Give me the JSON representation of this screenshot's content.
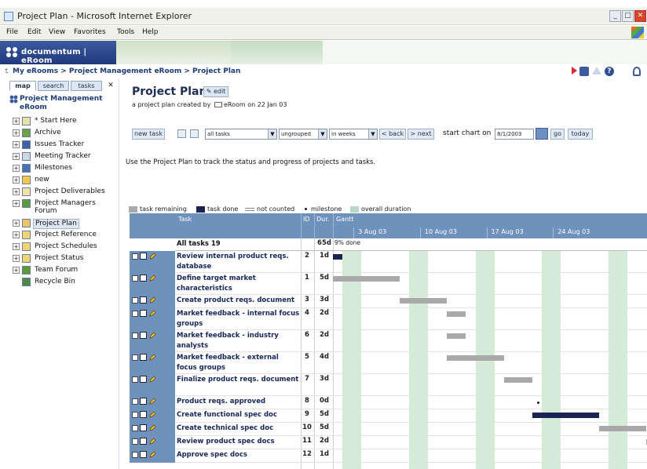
{
  "window": {
    "title": "Project Plan - Microsoft Internet Explorer"
  },
  "menu": [
    "File",
    "Edit",
    "View",
    "Favorites",
    "Tools",
    "Help"
  ],
  "brand": {
    "name": "documentum | eRoom"
  },
  "breadcrumb": "My eRooms > Project Management eRoom > Project Plan",
  "sidebar": {
    "tabs": [
      "map",
      "search",
      "tasks"
    ],
    "root": "Project Management eRoom",
    "items": [
      {
        "label": "* Start Here",
        "color": "#e9e2a6",
        "exp": "+"
      },
      {
        "label": "Archive",
        "color": "#6da14a",
        "exp": "+"
      },
      {
        "label": "Issues Tracker",
        "color": "#3f62a3",
        "exp": "+"
      },
      {
        "label": "Meeting Tracker",
        "color": "#cdd7e6",
        "exp": "+"
      },
      {
        "label": "Milestones",
        "color": "#4d6fb3",
        "exp": "+"
      },
      {
        "label": "new",
        "color": "#f2c94a",
        "exp": "+"
      },
      {
        "label": "Project Deliverables",
        "color": "#f2e3a8",
        "exp": "+"
      },
      {
        "label": "Project Managers",
        "label2": "Forum",
        "color": "#5d9a3f",
        "exp": "+"
      },
      {
        "label": "Project Plan",
        "color": "#e8c56a",
        "exp": "+",
        "selected": true
      },
      {
        "label": "Project Reference",
        "color": "#f0d478",
        "exp": "+"
      },
      {
        "label": "Project Schedules",
        "color": "#f0d478",
        "exp": "+"
      },
      {
        "label": "Project Status",
        "color": "#f0d478",
        "exp": "+"
      },
      {
        "label": "Team Forum",
        "color": "#5d9a3f",
        "exp": "+"
      },
      {
        "label": "Recycle Bin",
        "color": "#4d8a4a",
        "exp": ""
      }
    ]
  },
  "page": {
    "title": "Project Plan",
    "edit_label": "edit",
    "subtitle_before": "a project plan created by",
    "subtitle_after": "eRoom on 22 Jan 03",
    "description": "Use the Project Plan to track the status and progress of projects and tasks."
  },
  "toolbar": {
    "new_task": "new task",
    "filter": "all tasks",
    "grouping": "ungrouped",
    "scale": "in weeks",
    "back": "< back",
    "next": "> next",
    "start_label": "start chart on",
    "start_date": "8/1/2003",
    "go": "go",
    "today": "today"
  },
  "legend": {
    "remaining": "task remaining",
    "done": "task done",
    "not_counted": "not counted",
    "milestone": "milestone",
    "overall": "overall duration"
  },
  "colors": {
    "remaining": "#a9a9a9",
    "done": "#1b2352",
    "overall": "#b8d8c4",
    "header": "#6e92bc",
    "weekend": "#d5ebd7"
  },
  "grid": {
    "headers": {
      "task": "Task",
      "id": "ID",
      "dur": "Dur.",
      "gantt": "Gantt"
    },
    "dates": [
      "3 Aug 03",
      "10 Aug 03",
      "17 Aug 03",
      "24 Aug 03"
    ],
    "summary": {
      "label": "All tasks 19",
      "dur": "65d",
      "pct": "9% done"
    },
    "tasks": [
      {
        "name": "Review internal product reqs. database",
        "id": "2",
        "dur": "1d",
        "start": 0,
        "len": 1,
        "done": 1
      },
      {
        "name": "Define target market characteristics",
        "id": "1",
        "dur": "5d",
        "start": 0,
        "len": 7,
        "done": 0
      },
      {
        "name": "Create product reqs. document",
        "id": "3",
        "dur": "3d",
        "start": 7,
        "len": 5,
        "done": 0
      },
      {
        "name": "Market feedback - internal focus groups",
        "id": "4",
        "dur": "2d",
        "start": 12,
        "len": 2,
        "done": 0
      },
      {
        "name": "Market feedback - industry analysts",
        "id": "6",
        "dur": "2d",
        "start": 12,
        "len": 2,
        "done": 0
      },
      {
        "name": "Market feedback - external focus groups",
        "id": "5",
        "dur": "4d",
        "start": 12,
        "len": 6,
        "done": 0
      },
      {
        "name": "Finalize product reqs. document",
        "id": "7",
        "dur": "3d",
        "start": 18,
        "len": 3,
        "done": 0
      },
      {
        "name": "Product reqs. approved",
        "id": "8",
        "dur": "0d",
        "start": 21,
        "len": 0,
        "done": 0
      },
      {
        "name": "Create functional spec doc",
        "id": "9",
        "dur": "5d",
        "start": 21,
        "len": 7,
        "done": 1
      },
      {
        "name": "Create technical spec doc",
        "id": "10",
        "dur": "5d",
        "start": 28,
        "len": 5,
        "done": 0
      },
      {
        "name": "Review product spec docs",
        "id": "11",
        "dur": "2d",
        "start": 33,
        "len": 2,
        "done": 0
      },
      {
        "name": "Approve spec docs",
        "id": "12",
        "dur": "1d",
        "start": 35,
        "len": 1,
        "done": 0
      }
    ]
  }
}
